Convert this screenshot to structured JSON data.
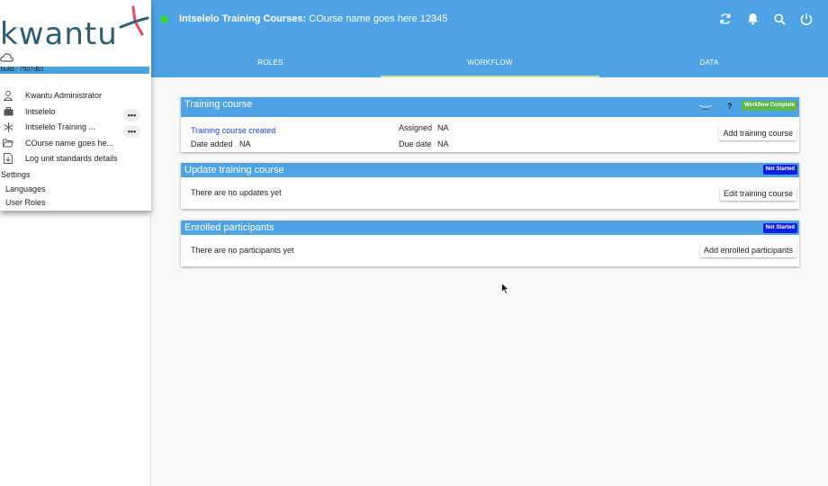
{
  "brand": {
    "logo_text": "kwantu",
    "build": "build : 7507db1"
  },
  "sidebar": {
    "items": [
      {
        "label": "Kwantu Administrator",
        "icon": "user-icon"
      },
      {
        "label": "Intselelo",
        "icon": "briefcase-icon",
        "more": "•••"
      },
      {
        "label": "Intselelo Training ...",
        "icon": "snowflake-icon",
        "more": "•••"
      },
      {
        "label": "COurse name goes he...",
        "icon": "folder-open-icon"
      },
      {
        "label": "Log unit standards details",
        "icon": "document-icon"
      }
    ],
    "settings_label": "Settings",
    "settings_items": [
      "Languages",
      "User Roles"
    ]
  },
  "header": {
    "status_color": "#36d43c",
    "title_bold": "Intselelo Training Courses:",
    "title_rest": " COurse name goes here 12345",
    "icons": [
      "refresh-icon",
      "bell-icon",
      "search-icon",
      "power-icon"
    ],
    "tabs": [
      {
        "label": "ROLES",
        "active": false
      },
      {
        "label": "WORKFLOW",
        "active": true
      },
      {
        "label": "DATA",
        "active": false
      }
    ]
  },
  "cards": {
    "training": {
      "title": "Training course",
      "status": "Workflow Complete",
      "help": "?",
      "link": "Training course created",
      "date_label": "Date added",
      "date_value": "NA",
      "assigned_label": "Assigned",
      "assigned_value": "NA",
      "due_label": "Due date",
      "due_value": "NA",
      "button": "Add training course"
    },
    "update": {
      "title": "Update training course",
      "status": "Not Started",
      "message": "There are no updates yet",
      "button": "Edit training course"
    },
    "enrolled": {
      "title": "Enrolled participants",
      "status": "Not Started",
      "message": "There are no participants yet",
      "button": "Add enrolled participants"
    }
  },
  "colors": {
    "accent": "#4da3e3",
    "complete": "#5cb84a",
    "not_started": "#1020e0",
    "link": "#1a3fc8"
  }
}
